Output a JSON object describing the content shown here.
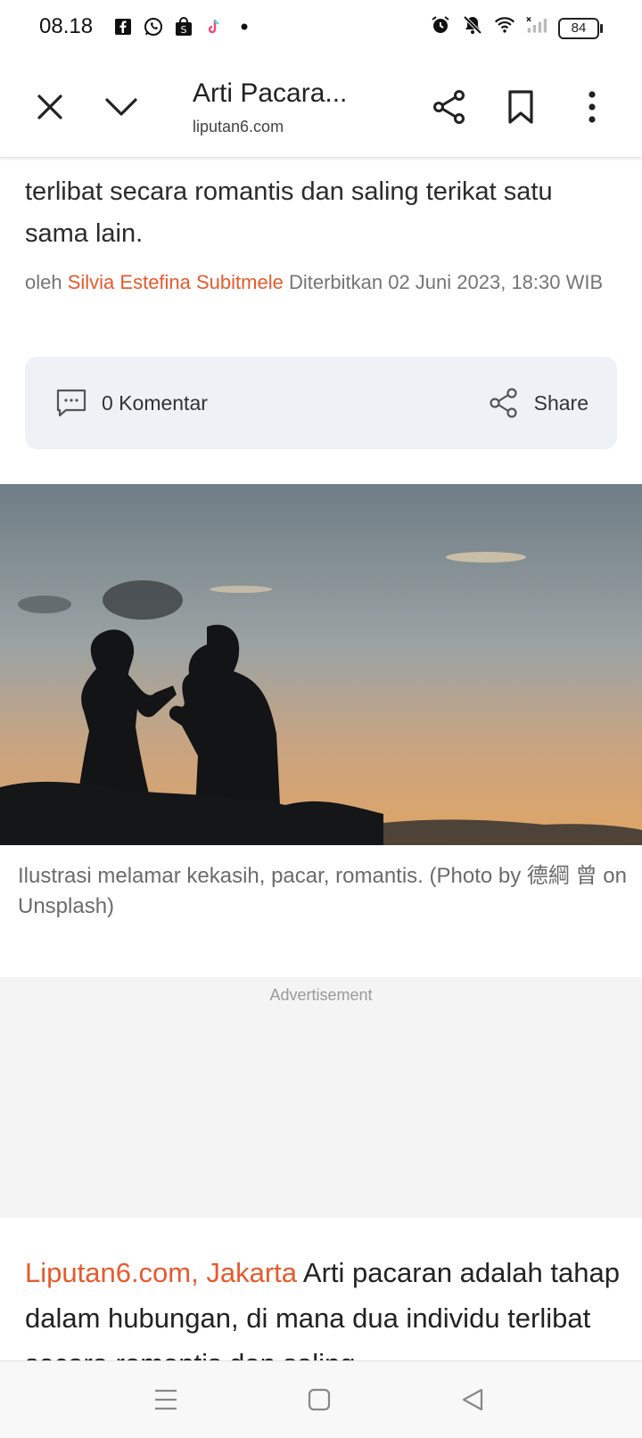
{
  "status_bar": {
    "time": "08.18",
    "battery": "84",
    "left_icons": [
      "facebook-icon",
      "whatsapp-icon",
      "shopee-icon",
      "tiktok-icon",
      "dot-icon"
    ],
    "right_icons": [
      "alarm-icon",
      "mute-icon",
      "wifi-icon",
      "signal-icon"
    ]
  },
  "toolbar": {
    "title": "Arti Pacara...",
    "domain": "liputan6.com"
  },
  "article": {
    "lead_text": "terlibat secara romantis dan saling terikat satu sama lain.",
    "byline_prefix": "oleh ",
    "author": "Silvia Estefina Subitmele",
    "published": " Diterbitkan 02 Juni 2023, 18:30 WIB",
    "comments_label": "0 Komentar",
    "share_label": "Share",
    "image_caption": "Ilustrasi melamar kekasih, pacar, romantis. (Photo by 德綱 曾 on Unsplash)",
    "ad_label": "Advertisement",
    "dateline": "Liputan6.com, Jakarta",
    "body_text": " Arti pacaran adalah tahap dalam hubungan, di mana dua individu terlibat secara romantis dan saling"
  },
  "colors": {
    "accent": "#e65a2c",
    "action_bar_bg": "#eef1f6"
  }
}
